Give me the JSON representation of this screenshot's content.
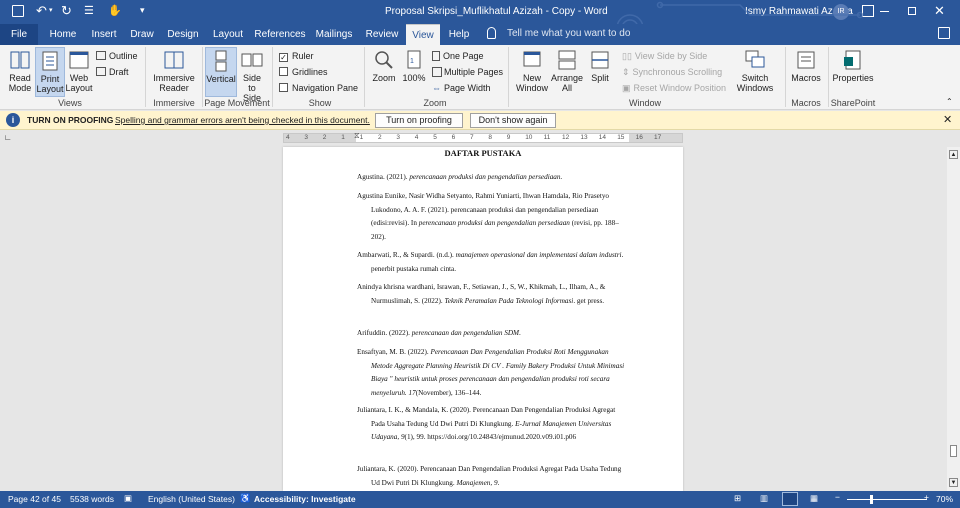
{
  "titlebar": {
    "doc_title": "Proposal Skripsi_Muflikhatul Azizah - Copy  -  Word",
    "user_name": "Ismy Rahmawati Azahra",
    "user_initials": "IR",
    "autosave_off": "Off"
  },
  "tabs": [
    "File",
    "Home",
    "Insert",
    "Draw",
    "Design",
    "Layout",
    "References",
    "Mailings",
    "Review",
    "View",
    "Help"
  ],
  "tell_me": "Tell me what you want to do",
  "ribbon": {
    "views": {
      "read_mode": "Read Mode",
      "print_layout": "Print Layout",
      "web_layout": "Web Layout",
      "outline": "Outline",
      "draft": "Draft",
      "label": "Views"
    },
    "immersive": {
      "reader": "Immersive Reader",
      "label": "Immersive"
    },
    "page_movement": {
      "vertical": "Vertical",
      "side_to_side": "Side to Side",
      "label": "Page Movement"
    },
    "show": {
      "ruler": "Ruler",
      "gridlines": "Gridlines",
      "nav_pane": "Navigation Pane",
      "label": "Show"
    },
    "zoom": {
      "zoom": "Zoom",
      "pct": "100%",
      "one_page": "One Page",
      "multiple_pages": "Multiple Pages",
      "page_width": "Page Width",
      "label": "Zoom"
    },
    "window": {
      "new_window": "New Window",
      "arrange_all": "Arrange All",
      "split": "Split",
      "view_side": "View Side by Side",
      "sync_scroll": "Synchronous Scrolling",
      "reset_pos": "Reset Window Position",
      "switch_windows": "Switch Windows",
      "label": "Window"
    },
    "macros": {
      "macros": "Macros",
      "label": "Macros"
    },
    "sharepoint": {
      "properties": "Properties",
      "label": "SharePoint"
    }
  },
  "msgbar": {
    "title": "TURN ON PROOFING",
    "text": "Spelling and grammar errors aren't being checked in this document.",
    "btn_on": "Turn on proofing",
    "btn_dismiss": "Don't show again"
  },
  "ruler_ticks": [
    "4",
    "3",
    "2",
    "1",
    "1",
    "2",
    "3",
    "4",
    "5",
    "6",
    "7",
    "8",
    "9",
    "10",
    "11",
    "12",
    "13",
    "14",
    "15",
    "16",
    "17"
  ],
  "document": {
    "heading": "DAFTAR PUSTAKA",
    "refs": [
      [
        "Agustina. (2021). ",
        "perencanaan produksi dan pengendalian persediaan.",
        ""
      ],
      [
        "Agustina Eunike, Nasir Widha Setyanto, Rahmi Yuniarti, Ihwan Hamdala, Rio Prasetyo Lukodono, A. A. F. (2021). perencanaan produksi dan pengendalian persediaan (edisi:revisi). In ",
        "perencanaan produksi dan pengendalian persediaan",
        " (revisi, pp. 188–202)."
      ],
      [
        "Ambarwati, R., & Supardi. (n.d.). ",
        "manajemen operasional dan implementasi dalam industri",
        ". penerbit pustaka rumah cinta."
      ],
      [
        "Anindya khrisna wardhani, Israwan, F., Setiawan, J., S, W., Khikmah, L., Ilham, A., & Nurmuslimah, S. (2022). ",
        "Teknik Peramalan Pada Teknologi Informasi",
        ". get press."
      ],
      [
        "Arifuddin. (2022). ",
        "perencanaan dan pengendalian SDM",
        "."
      ],
      [
        "Ensaftyan, M. B. (2022). ",
        "Perencanaan Dan Pengendalian Produksi Roti Menggunakan Metode Aggregate Planning Heuristik Di CV . Family Bakery Produksi Untuk Minimasi Biaya \" heuristik untuk proses perencanaan dan pengendalian produksi roti secara menyeluruh. 17",
        "(November), 136–144."
      ],
      [
        "Juliantara, I. K., & Mandala, K. (2020). Perencanaan Dan Pengendalian Produksi Agregat Pada Usaha Tedung Ud Dwi Putri Di Klungkung. ",
        "E-Jurnal Manajemen Universitas Udayana, 9",
        "(1), 99. https://doi.org/10.24843/ejmunud.2020.v09.i01.p06"
      ],
      [
        "Juliantara, K. (2020). Perencanaan Dan Pengendalian Produksi Agregat Pada Usaha Tedung Ud Dwi Putri Di Klungkung. ",
        "Manajemen, 9",
        "."
      ]
    ]
  },
  "statusbar": {
    "page": "Page 42 of 45",
    "words": "5538 words",
    "language": "English (United States)",
    "accessibility": "Accessibility: Investigate",
    "zoom": "70%"
  },
  "colors": {
    "accent": "#2b579a",
    "message_bar": "#fff4ce"
  }
}
